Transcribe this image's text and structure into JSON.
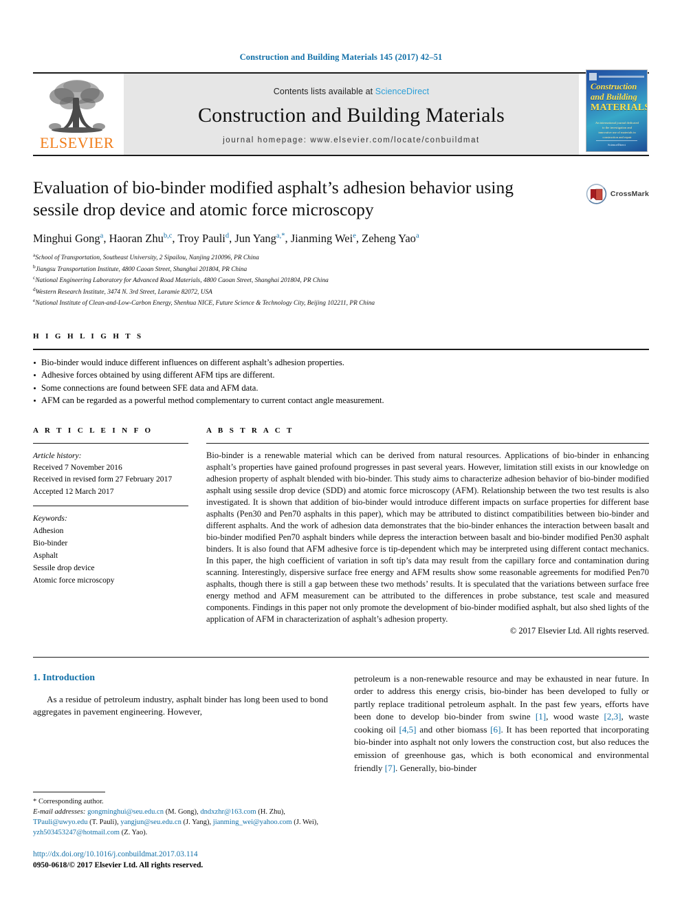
{
  "running_head": "Construction and Building Materials 145 (2017) 42–51",
  "masthead": {
    "publisher_name": "ELSEVIER",
    "contents_prefix": "Contents lists available at ",
    "contents_link": "ScienceDirect",
    "journal_title": "Construction and Building Materials",
    "homepage": "journal homepage: www.elsevier.com/locate/conbuildmat",
    "cover": {
      "line1": "Construction",
      "line2": "and Building",
      "line3": "MATERIALS",
      "blurb": "An international journal dedicated to the investigation and innovative use of materials in construction and repair",
      "foot": "ScienceDirect"
    }
  },
  "article": {
    "title": "Evaluation of bio-binder modified asphalt’s adhesion behavior using sessile drop device and atomic force microscopy",
    "crossmark_label": "CrossMark",
    "authors": [
      {
        "name": "Minghui Gong",
        "sup": "a"
      },
      {
        "name": "Haoran Zhu",
        "sup": "b,c"
      },
      {
        "name": "Troy Pauli",
        "sup": "d"
      },
      {
        "name": "Jun Yang",
        "sup": "a,*"
      },
      {
        "name": "Jianming Wei",
        "sup": "e"
      },
      {
        "name": "Zeheng Yao",
        "sup": "a"
      }
    ],
    "affiliations": [
      {
        "mark": "a",
        "text": "School of Transportation, Southeast University, 2 Sipailou, Nanjing 210096, PR China"
      },
      {
        "mark": "b",
        "text": "Jiangsu Transportation Institute, 4800 Caoan Street, Shanghai 201804, PR China"
      },
      {
        "mark": "c",
        "text": "National Engineering Laboratory for Advanced Road Materials, 4800 Caoan Street, Shanghai 201804, PR China"
      },
      {
        "mark": "d",
        "text": "Western Research Institute, 3474 N. 3rd Street, Laramie 82072, USA"
      },
      {
        "mark": "e",
        "text": "National Institute of Clean-and-Low-Carbon Energy, Shenhua NICE, Future Science & Technology City, Beijing 102211, PR China"
      }
    ]
  },
  "highlights": {
    "heading": "H I G H L I G H T S",
    "items": [
      "Bio-binder would induce different influences on different asphalt’s adhesion properties.",
      "Adhesive forces obtained by using different AFM tips are different.",
      "Some connections are found between SFE data and AFM data.",
      "AFM can be regarded as a powerful method complementary to current contact angle measurement."
    ]
  },
  "article_info": {
    "heading": "A R T I C L E   I N F O",
    "history_label": "Article history:",
    "history": [
      "Received 7 November 2016",
      "Received in revised form 27 February 2017",
      "Accepted 12 March 2017"
    ],
    "keywords_label": "Keywords:",
    "keywords": [
      "Adhesion",
      "Bio-binder",
      "Asphalt",
      "Sessile drop device",
      "Atomic force microscopy"
    ]
  },
  "abstract": {
    "heading": "A B S T R A C T",
    "text": "Bio-binder is a renewable material which can be derived from natural resources. Applications of bio-binder in enhancing asphalt’s properties have gained profound progresses in past several years. However, limitation still exists in our knowledge on adhesion property of asphalt blended with bio-binder. This study aims to characterize adhesion behavior of bio-binder modified asphalt using sessile drop device (SDD) and atomic force microscopy (AFM). Relationship between the two test results is also investigated. It is shown that addition of bio-binder would introduce different impacts on surface properties for different base asphalts (Pen30 and Pen70 asphalts in this paper), which may be attributed to distinct compatibilities between bio-binder and different asphalts. And the work of adhesion data demonstrates that the bio-binder enhances the interaction between basalt and bio-binder modified Pen70 asphalt binders while depress the interaction between basalt and bio-binder modified Pen30 asphalt binders. It is also found that AFM adhesive force is tip-dependent which may be interpreted using different contact mechanics. In this paper, the high coefficient of variation in soft tip’s data may result from the capillary force and contamination during scanning. Interestingly, dispersive surface free energy and AFM results show some reasonable agreements for modified Pen70 asphalts, though there is still a gap between these two methods’ results. It is speculated that the variations between surface free energy method and AFM measurement can be attributed to the differences in probe substance, test scale and measured components. Findings in this paper not only promote the development of bio-binder modified asphalt, but also shed lights of the application of AFM in characterization of asphalt’s adhesion property.",
    "copyright": "© 2017 Elsevier Ltd. All rights reserved."
  },
  "body": {
    "section_title": "1. Introduction",
    "left_paragraph": "As a residue of petroleum industry, asphalt binder has long been used to bond aggregates in pavement engineering. However,",
    "right_paragraph_parts": [
      {
        "t": "petroleum is a non-renewable resource and may be exhausted in near future. In order to address this energy crisis, bio-binder has been developed to fully or partly replace traditional petroleum asphalt. In the past few years, efforts have been done to develop bio-binder from swine ",
        "type": "text"
      },
      {
        "t": "[1]",
        "type": "ref"
      },
      {
        "t": ", wood waste ",
        "type": "text"
      },
      {
        "t": "[2,3]",
        "type": "ref"
      },
      {
        "t": ", waste cooking oil ",
        "type": "text"
      },
      {
        "t": "[4,5]",
        "type": "ref"
      },
      {
        "t": " and other biomass ",
        "type": "text"
      },
      {
        "t": "[6]",
        "type": "ref"
      },
      {
        "t": ". It has been reported that incorporating bio-binder into asphalt not only lowers the construction cost, but also reduces the emission of greenhouse gas, which is both economical and environmental friendly ",
        "type": "text"
      },
      {
        "t": "[7]",
        "type": "ref"
      },
      {
        "t": ". Generally, bio-binder",
        "type": "text"
      }
    ]
  },
  "footnote": {
    "corresponding": "* Corresponding author.",
    "email_label": "E-mail addresses:",
    "emails": [
      {
        "addr": "gongminghui@seu.edu.cn",
        "who": "(M. Gong)"
      },
      {
        "addr": "dndxzhr@163.com",
        "who": "(H. Zhu)"
      },
      {
        "addr": "TPauli@uwyo.edu",
        "who": "(T. Pauli)"
      },
      {
        "addr": "yangjun@seu.edu.cn",
        "who": "(J. Yang)"
      },
      {
        "addr": "jianming_wei@yahoo.com",
        "who": "(J. Wei)"
      },
      {
        "addr": "yzh503453247@hotmail.com",
        "who": "(Z. Yao)"
      }
    ],
    "doi": "http://dx.doi.org/10.1016/j.conbuildmat.2017.03.114",
    "issn": "0950-0618/© 2017 Elsevier Ltd. All rights reserved."
  },
  "colors": {
    "link_blue": "#1270a8",
    "sciencedirect_blue": "#2b9fd8",
    "elsevier_orange": "#f07d1a",
    "band_gray": "#e6e6e6"
  }
}
